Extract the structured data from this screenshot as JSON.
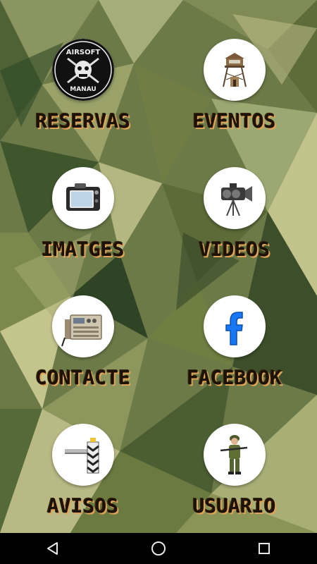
{
  "menu": {
    "items": [
      {
        "label": "RESERVAS",
        "icon": "airsoft-manau-logo-icon"
      },
      {
        "label": "EVENTOS",
        "icon": "watchtower-icon"
      },
      {
        "label": "IMATGES",
        "icon": "camera-icon"
      },
      {
        "label": "VIDEOS",
        "icon": "video-camera-icon"
      },
      {
        "label": "CONTACTE",
        "icon": "radio-transceiver-icon"
      },
      {
        "label": "FACEBOOK",
        "icon": "facebook-icon"
      },
      {
        "label": "AVISOS",
        "icon": "warning-barrier-icon"
      },
      {
        "label": "USUARIO",
        "icon": "soldier-icon"
      }
    ]
  },
  "logo": {
    "top_text": "AIRSOFT",
    "bottom_text": "MANAU"
  },
  "navbar": {
    "back": "back-icon",
    "home": "home-icon",
    "recents": "recents-icon"
  },
  "colors": {
    "label_text": "#1c1208",
    "label_glow": "#e0a458",
    "facebook_blue": "#1877f2",
    "navbar_bg": "#000000"
  }
}
